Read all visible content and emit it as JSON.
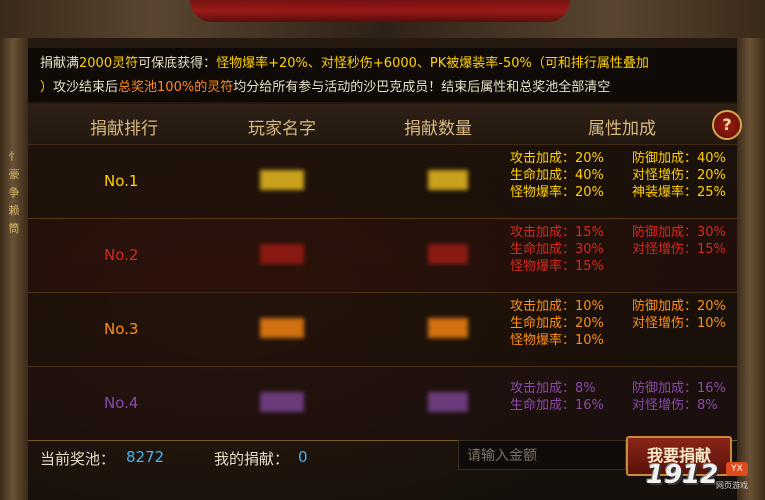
{
  "notice": {
    "line1_a": "捐献满",
    "line1_b": "2000灵符",
    "line1_c": "可保底获得：",
    "line1_d": "怪物爆率+20%、对怪秒伤+6000、PK被爆装率-50%（可和排行属性叠加",
    "line2_a": "）",
    "line2_b": "攻沙结束后",
    "line2_c": "总奖池100%的灵符",
    "line2_d": "均分给所有参与活动的沙巴克成员！结束后属性和总奖池全部清空"
  },
  "table": {
    "headers": [
      "捐献排行",
      "玩家名字",
      "捐献数量",
      "属性加成"
    ],
    "help": "?",
    "rows": [
      {
        "rank": "No.1",
        "color": "#ffd200",
        "name_color": "#c8a21c",
        "attrs": [
          "攻击加成：20%",
          "防御加成：40%",
          "生命加成：40%",
          "对怪增伤：20%",
          "怪物爆率：20%",
          "神装爆率：25%"
        ]
      },
      {
        "rank": "No.2",
        "color": "#d42a1e",
        "name_color": "#8a1a12",
        "attrs": [
          "攻击加成：15%",
          "防御加成：30%",
          "生命加成：30%",
          "对怪增伤：15%",
          "怪物爆率：15%",
          ""
        ]
      },
      {
        "rank": "No.3",
        "color": "#ff9010",
        "name_color": "#d07010",
        "attrs": [
          "攻击加成：10%",
          "防御加成：20%",
          "生命加成：20%",
          "对怪增伤：10%",
          "怪物爆率：10%",
          ""
        ]
      },
      {
        "rank": "No.4",
        "color": "#8a4aa8",
        "name_color": "#6a3a7a",
        "attrs": [
          "攻击加成：8%",
          "防御加成：16%",
          "生命加成：16%",
          "对怪增伤：8%",
          "",
          ""
        ]
      }
    ]
  },
  "footer": {
    "pool_label": "当前奖池：",
    "pool_value": "8272",
    "my_label": "我的捐献：",
    "my_value": "0",
    "input_placeholder": "请输入金额",
    "donate_label": "我要捐献"
  },
  "logo": {
    "number": "1912",
    "badge": "YX",
    "sub": "网页游戏"
  },
  "side": {
    "glyphs": "忄 豪 争 赖 筒"
  }
}
